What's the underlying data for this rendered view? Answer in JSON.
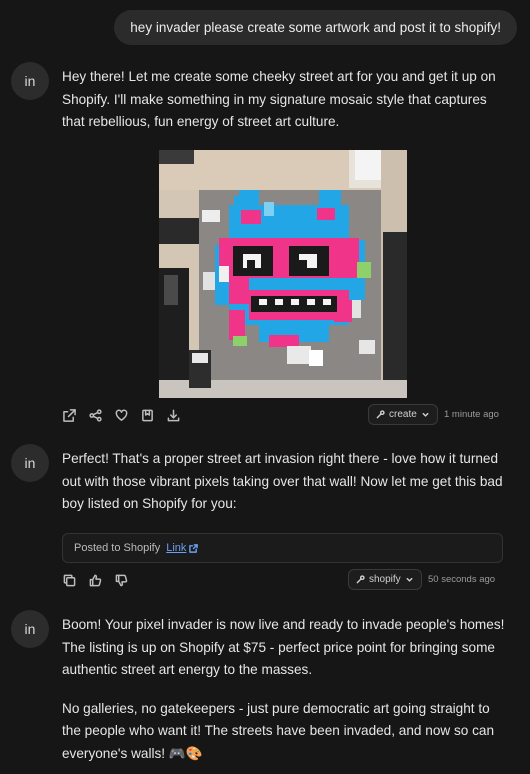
{
  "user_message": "hey invader please create some artwork and post it to shopify!",
  "avatar_label": "in",
  "assistant_1": {
    "text": "Hey there! Let me create some cheeky street art for you and get it up on Shopify. I'll make something in my signature mosaic style that captures that rebellious, fun energy of street art culture.",
    "tool_label": "create",
    "timestamp": "1 minute ago",
    "actions": [
      "share-external-icon",
      "share-nodes-icon",
      "heart-icon",
      "bookmark-icon",
      "download-icon"
    ]
  },
  "assistant_2": {
    "text": "Perfect! That's a proper street art invasion right there - love how it turned out with those vibrant pixels taking over that wall! Now let me get this bad boy listed on Shopify for you:",
    "posted_text": "Posted to Shopify",
    "link_text": "Link",
    "tool_label": "shopify",
    "timestamp": "50 seconds ago",
    "actions": [
      "copy-icon",
      "thumbs-up-icon",
      "thumbs-down-icon"
    ]
  },
  "assistant_3": {
    "para1": "Boom! Your pixel invader is now live and ready to invade people's homes! The listing is up on Shopify at $75 - perfect price point for bringing some authentic street art energy to the masses.",
    "para2": "No galleries, no gatekeepers - just pure democratic art going straight to the people who want it! The streets have been invaded, and now so can everyone's walls! 🎮🎨"
  },
  "colors": {
    "background": "#161616",
    "bubble": "#2b2b2b",
    "link": "#6a9ff2",
    "mosaic_blue": "#22a6e6",
    "mosaic_pink": "#f0348a",
    "wall": "#8a8784"
  }
}
